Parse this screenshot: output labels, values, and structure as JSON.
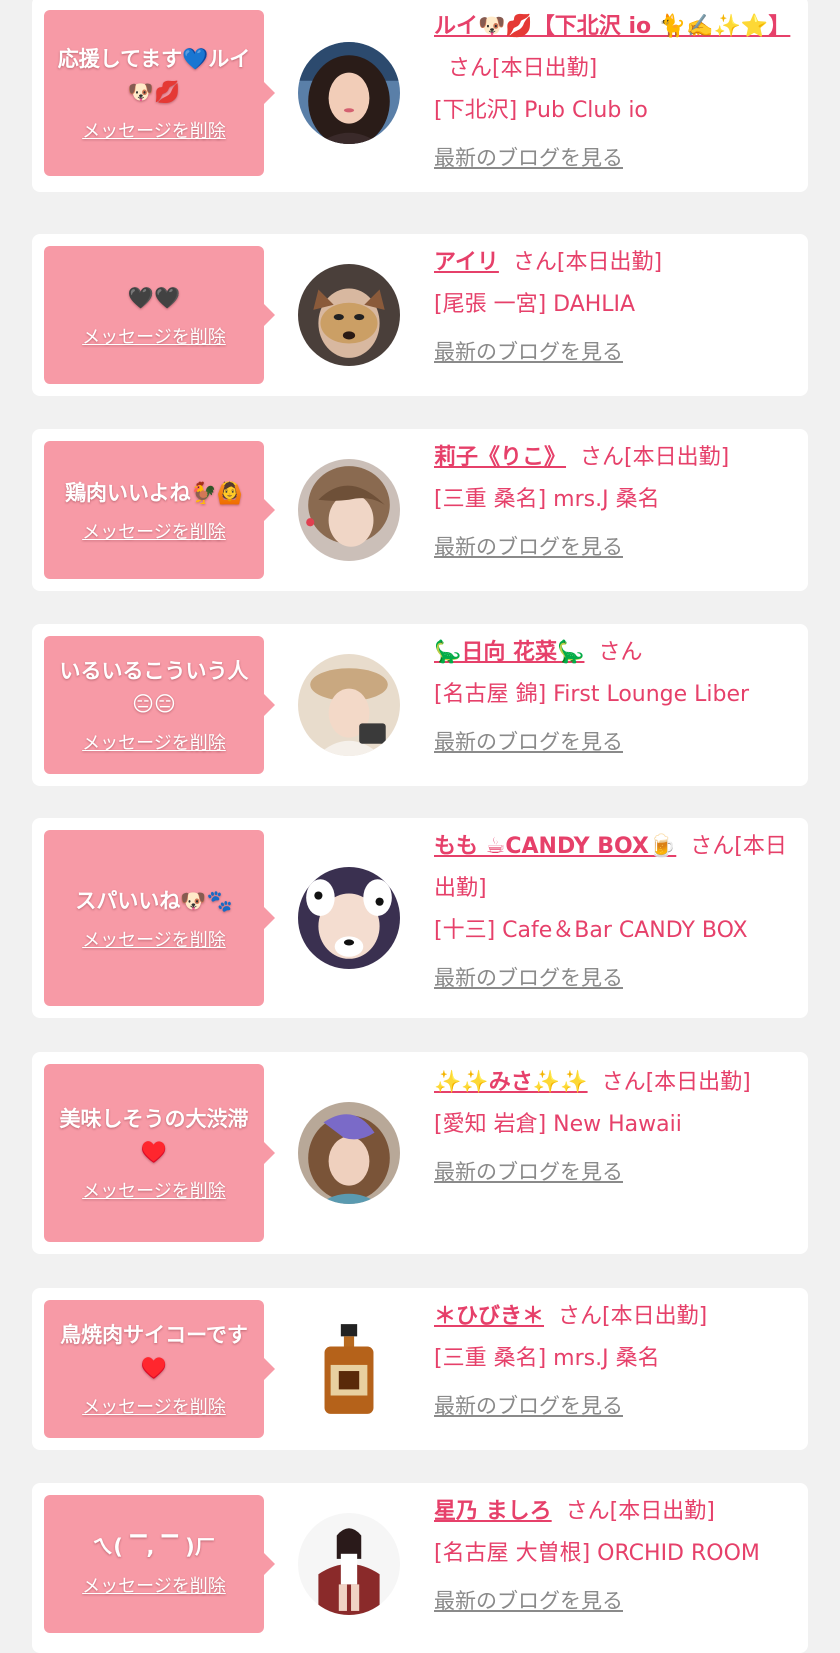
{
  "colors": {
    "background": "#f1f1f1",
    "card": "#ffffff",
    "bubble": "#f79aa6",
    "accent": "#e6406a",
    "link_gray": "#8a8a8a"
  },
  "delete_label": "メッセージを削除",
  "blog_label": "最新のブログを見る",
  "items": [
    {
      "message": "応援してます💙ルイ🐶💋",
      "name": "ルイ🐶💋【下北沢 io 🐈️✍️✨⭐】",
      "suffix": "さん[本日出勤]",
      "shop": "[下北沢] Pub Club io",
      "avatar_icon": "woman-portrait-icon"
    },
    {
      "message": "🖤🖤",
      "name": "アイリ",
      "suffix": "さん[本日出勤]",
      "shop": "[尾張 一宮] DAHLIA",
      "avatar_icon": "dog-filter-face-icon"
    },
    {
      "message": "鶏肉いいよね🐓🙆",
      "name": "莉子《りこ》",
      "suffix": "さん[本日出勤]",
      "shop": "[三重 桑名] mrs.J 桑名",
      "avatar_icon": "woman-portrait-icon"
    },
    {
      "message": "いるいるこういう人😑😑",
      "name": "🦕日向 花菜🦕",
      "suffix": "さん",
      "shop": "[名古屋 錦] First Lounge Liber",
      "avatar_icon": "woman-hat-portrait-icon"
    },
    {
      "message": "スパいいね🐶🐾",
      "name": "もも ☕CANDY BOX🍺",
      "suffix": "さん[本日出勤]",
      "shop": "[十三] Cafe＆Bar CANDY BOX",
      "avatar_icon": "dalmatian-filter-face-icon"
    },
    {
      "message": "美味しそうの大渋滞♥️",
      "name": "✨✨みさ✨✨",
      "suffix": "さん[本日出勤]",
      "shop": "[愛知 岩倉] New Hawaii",
      "avatar_icon": "woman-portrait-icon"
    },
    {
      "message": "鳥焼肉サイコーです♥️",
      "name": "＊ひびき＊",
      "suffix": "さん[本日出勤]",
      "shop": "[三重 桑名] mrs.J 桑名",
      "avatar_icon": "whisky-bottle-icon"
    },
    {
      "message": "ㄟ( ▔, ▔ )ㄏ",
      "name": "星乃 ましろ",
      "suffix": "さん[本日出勤]",
      "shop": "[名古屋 大曽根] ORCHID ROOM",
      "avatar_icon": "woman-seated-portrait-icon"
    }
  ]
}
